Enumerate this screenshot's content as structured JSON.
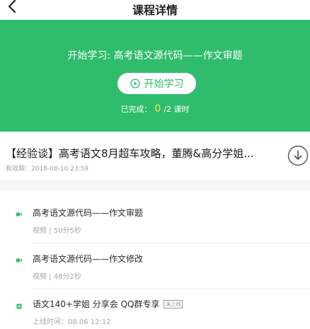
{
  "nav": {
    "title": "课程详情",
    "back_icon": "chevron-left-icon"
  },
  "hero": {
    "title": "开始学习: 高考语文源代码——作文审题",
    "start_button": "开始学习",
    "start_icon": "play-circle-icon",
    "progress_label": "已完成：",
    "progress_done": "0",
    "progress_total": "/2 课时",
    "background": "#2fbc6c",
    "accent": "#ffe14a"
  },
  "course": {
    "title": "【经验谈】高考语文8月超车攻略，董腾&高分学姐...",
    "expiry": "有效期：2018-08-10 23:59",
    "download_icon": "download-circle-icon"
  },
  "lessons": [
    {
      "title": "高考语文源代码——作文审题",
      "meta": "视频 | 50分5秒",
      "badge": ""
    },
    {
      "title": "高考语文源代码——作文修改",
      "meta": "视频 | 48分2秒",
      "badge": ""
    },
    {
      "title": "语文140+学姐 分享会 QQ群专享",
      "meta": "上线时间：08.06 12:12",
      "badge": "未上线"
    }
  ]
}
